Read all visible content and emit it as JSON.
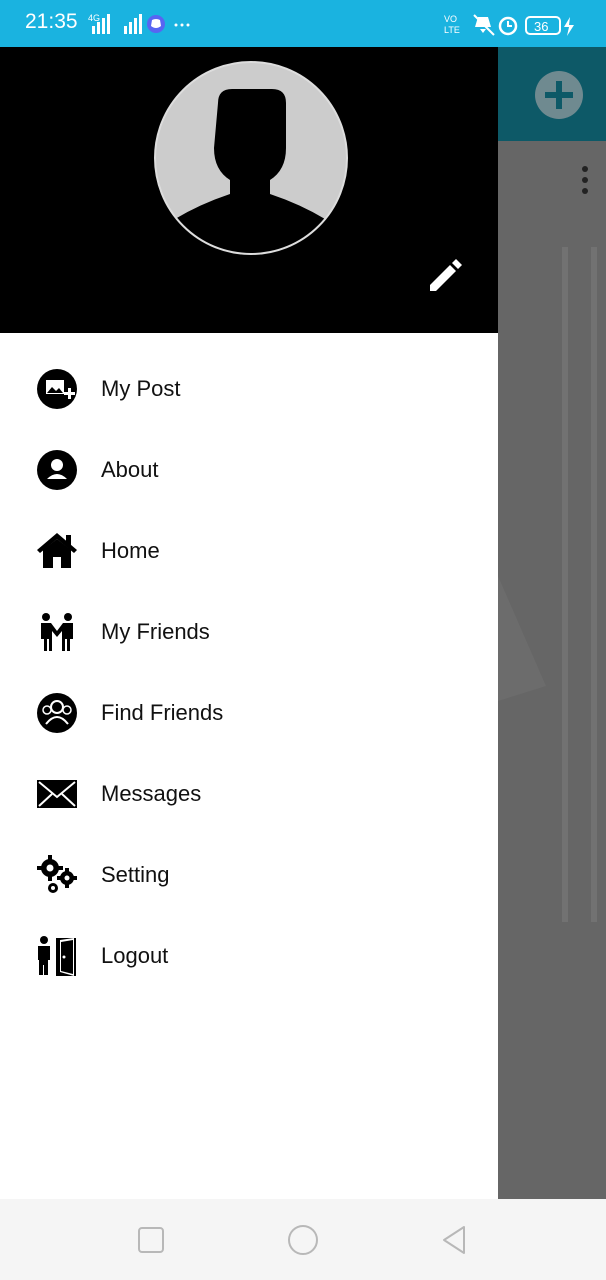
{
  "status_bar": {
    "time": "21:35",
    "network_label": "4G",
    "volte_label_line1": "VO",
    "volte_label_line2": "LTE",
    "battery_level": "36"
  },
  "drawer": {
    "menu_items": [
      {
        "label": "My Post",
        "icon": "image-add-icon"
      },
      {
        "label": "About",
        "icon": "person-circle-icon"
      },
      {
        "label": "Home",
        "icon": "home-icon"
      },
      {
        "label": "My Friends",
        "icon": "friends-icon"
      },
      {
        "label": "Find Friends",
        "icon": "group-circle-icon"
      },
      {
        "label": "Messages",
        "icon": "envelope-icon"
      },
      {
        "label": "Setting",
        "icon": "gears-icon"
      },
      {
        "label": "Logout",
        "icon": "logout-door-icon"
      }
    ]
  },
  "colors": {
    "status_bar": "#1ab3e0",
    "app_toolbar": "#0d5967",
    "scrim": "#666666"
  }
}
